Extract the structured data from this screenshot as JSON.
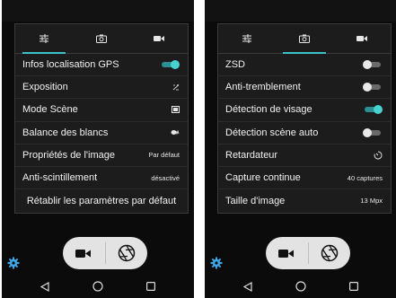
{
  "colors": {
    "accent": "#3ac2c8",
    "toggle_on": "#48d2cf"
  },
  "screens": [
    {
      "tabs": [
        {
          "icon": "sliders-icon",
          "active": true
        },
        {
          "icon": "camera-icon",
          "active": false
        },
        {
          "icon": "video-icon",
          "active": false
        }
      ],
      "rows": [
        {
          "label": "Infos localisation GPS",
          "toggle": "on"
        },
        {
          "label": "Exposition",
          "icon": "exposure-icon"
        },
        {
          "label": "Mode Scène",
          "icon": "scene-icon"
        },
        {
          "label": "Balance des blancs",
          "icon": "awb-icon"
        },
        {
          "label": "Propriétés de l'image",
          "value": "Par défaut"
        },
        {
          "label": "Anti-scintillement",
          "value": "désactivé"
        }
      ],
      "reset_label": "Rétablir les paramètres par défaut"
    },
    {
      "tabs": [
        {
          "icon": "sliders-icon",
          "active": false
        },
        {
          "icon": "camera-icon",
          "active": true
        },
        {
          "icon": "video-icon",
          "active": false
        }
      ],
      "rows": [
        {
          "label": "ZSD",
          "toggle": "off"
        },
        {
          "label": "Anti-tremblement",
          "toggle": "off"
        },
        {
          "label": "Détection de visage",
          "toggle": "on"
        },
        {
          "label": "Détection scène auto",
          "toggle": "off"
        },
        {
          "label": "Retardateur",
          "icon": "timer-icon"
        },
        {
          "label": "Capture continue",
          "value": "40 captures"
        },
        {
          "label": "Taille d'image",
          "value": "13 Mpx"
        }
      ]
    }
  ],
  "capture_buttons": [
    "video-camera-icon",
    "shutter-icon"
  ],
  "settings_icon": "settings-gear-icon",
  "navbar": [
    "back-icon",
    "home-icon",
    "recents-icon"
  ]
}
